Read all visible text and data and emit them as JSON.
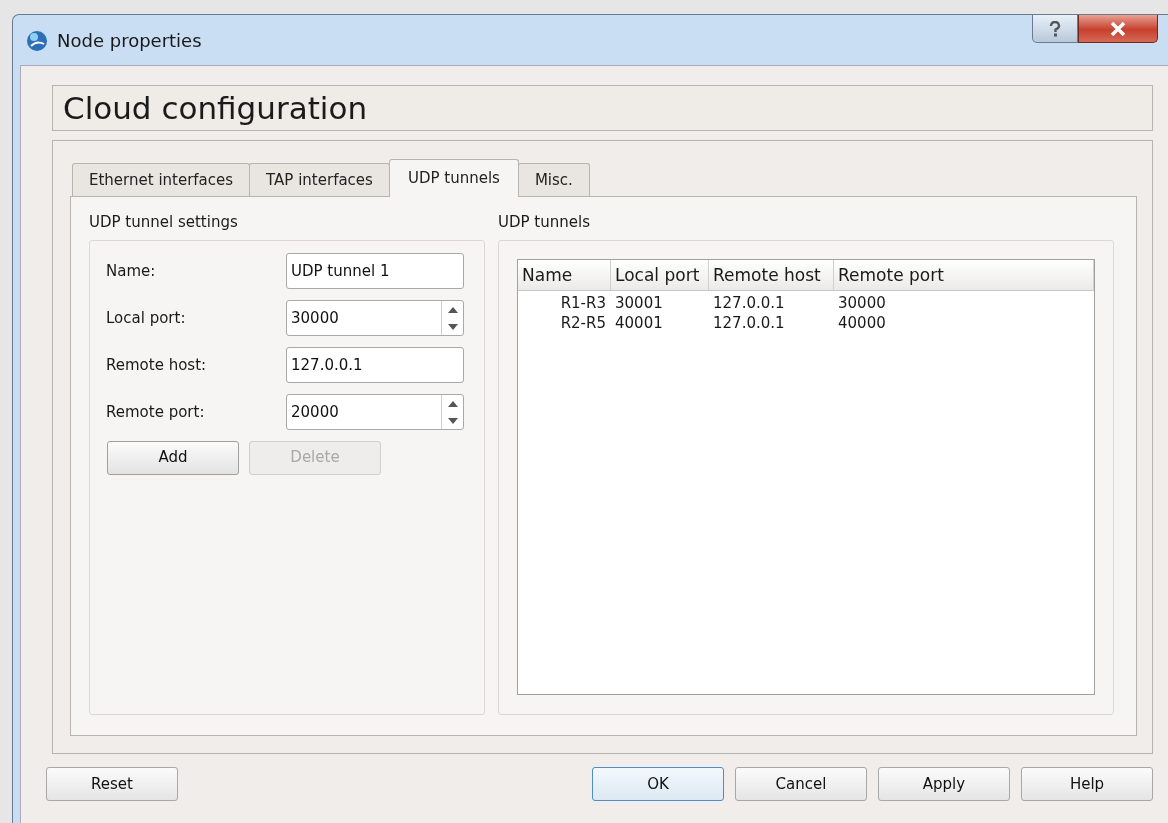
{
  "window": {
    "title": "Node properties"
  },
  "header": "Cloud configuration",
  "tabs": [
    {
      "label": "Ethernet interfaces",
      "selected": false
    },
    {
      "label": "TAP interfaces",
      "selected": false
    },
    {
      "label": "UDP tunnels",
      "selected": true
    },
    {
      "label": "Misc.",
      "selected": false
    }
  ],
  "settings": {
    "title": "UDP tunnel settings",
    "fields": [
      {
        "label": "Name:",
        "value": "UDP tunnel 1",
        "kind": "text"
      },
      {
        "label": "Local port:",
        "value": "30000",
        "kind": "spin"
      },
      {
        "label": "Remote host:",
        "value": "127.0.0.1",
        "kind": "text"
      },
      {
        "label": "Remote port:",
        "value": "20000",
        "kind": "spin"
      }
    ],
    "buttons": [
      {
        "label": "Add",
        "disabled": false
      },
      {
        "label": "Delete",
        "disabled": true
      }
    ]
  },
  "tunnels": {
    "title": "UDP tunnels",
    "columns": [
      "Name",
      "Local port",
      "Remote host",
      "Remote port"
    ],
    "rows": [
      [
        "R1-R3",
        "30001",
        "127.0.0.1",
        "30000"
      ],
      [
        "R2-R5",
        "40001",
        "127.0.0.1",
        "40000"
      ]
    ]
  },
  "footer_buttons": [
    {
      "label": "Reset",
      "default": false
    },
    {
      "label": "OK",
      "default": true
    },
    {
      "label": "Cancel",
      "default": false
    },
    {
      "label": "Apply",
      "default": false
    },
    {
      "label": "Help",
      "default": false
    }
  ]
}
